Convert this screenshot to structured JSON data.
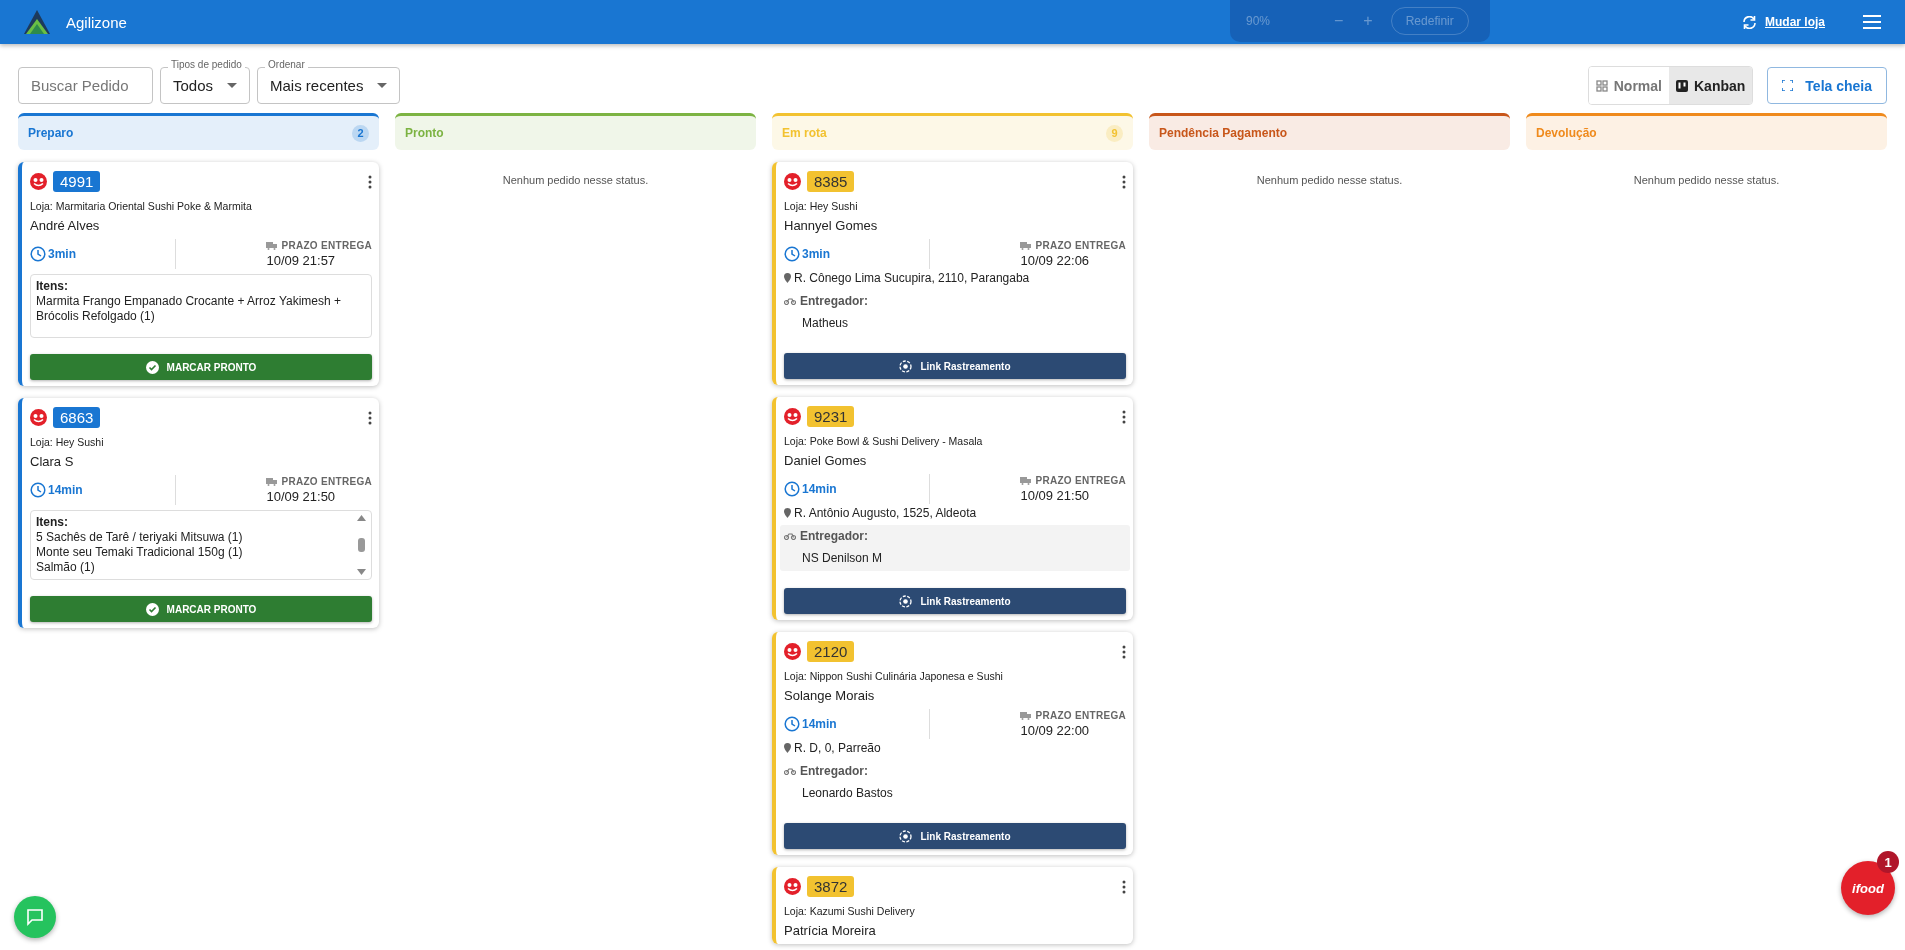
{
  "header": {
    "title": "Agilizone",
    "zoom": {
      "value": "90%",
      "minus": "−",
      "plus": "+",
      "reset": "Redefinir"
    },
    "store_link": "Mudar loja"
  },
  "toolbar": {
    "search": {
      "placeholder": "Buscar Pedido"
    },
    "filters": [
      {
        "label": "Tipos de pedido",
        "value": "Todos"
      },
      {
        "label": "Ordenar",
        "value": "Mais recentes"
      }
    ],
    "views": [
      {
        "label": "Normal",
        "selected": false,
        "kind": "grid"
      },
      {
        "label": "Kanban",
        "selected": true,
        "kind": "kanban"
      }
    ],
    "fullscreen": "Tela cheia"
  },
  "columns": [
    {
      "title": "Preparo",
      "color": "#1976d2",
      "count": "2",
      "cards": [
        {
          "number": "4991",
          "store": "Loja: Marmitaria Oriental Sushi Poke & Marmita",
          "customer": "André Alves",
          "elapsed": "3min",
          "deadline_label": "PRAZO ENTREGA",
          "deadline": "10/09 21:57",
          "items_label": "Itens:",
          "items": [
            "Marmita Frango Empanado Crocante + Arroz Yakimesh + Brócolis Refolgado (1)"
          ],
          "scrollable": false,
          "action": "MARCAR PRONTO"
        },
        {
          "number": "6863",
          "store": "Loja: Hey Sushi",
          "customer": "Clara S",
          "elapsed": "14min",
          "deadline_label": "PRAZO ENTREGA",
          "deadline": "10/09 21:50",
          "items_label": "Itens:",
          "items": [
            "5 Sachês de Tarê / teriyaki Mitsuwa (1)",
            "Monte seu Temaki Tradicional 150g (1)",
            "Salmão (1)"
          ],
          "scrollable": true,
          "action": "MARCAR PRONTO"
        }
      ]
    },
    {
      "title": "Pronto",
      "color": "#7cb342",
      "empty": "Nenhum pedido nesse status."
    },
    {
      "title": "Em rota",
      "color": "#f2c230",
      "count": "9",
      "cards": [
        {
          "number": "8385",
          "store": "Loja: Hey Sushi",
          "customer": "Hannyel Gomes",
          "elapsed": "3min",
          "deadline_label": "PRAZO ENTREGA",
          "deadline": "10/09 22:06",
          "address": "R. Cônego Lima Sucupira, 2110, Parangaba",
          "courier_label": "Entregador:",
          "courier": "Matheus",
          "highlighted": false,
          "action": "Link Rastreamento"
        },
        {
          "number": "9231",
          "store": "Loja: Poke Bowl & Sushi Delivery - Masala",
          "customer": "Daniel Gomes",
          "elapsed": "14min",
          "deadline_label": "PRAZO ENTREGA",
          "deadline": "10/09 21:50",
          "address": "R. Antônio Augusto, 1525, Aldeota",
          "courier_label": "Entregador:",
          "courier": "NS Denilson M",
          "highlighted": true,
          "action": "Link Rastreamento"
        },
        {
          "number": "2120",
          "store": "Loja: Nippon Sushi Culinária Japonesa e Sushi",
          "customer": "Solange Morais",
          "elapsed": "14min",
          "deadline_label": "PRAZO ENTREGA",
          "deadline": "10/09 22:00",
          "address": "R. D, 0, Parreão",
          "courier_label": "Entregador:",
          "courier": "Leonardo Bastos",
          "highlighted": false,
          "action": "Link Rastreamento"
        },
        {
          "number": "3872",
          "store": "Loja: Kazumi Sushi Delivery",
          "customer": "Patrícia Moreira"
        }
      ]
    },
    {
      "title": "Pendência Pagamento",
      "color": "#c8561a",
      "empty": "Nenhum pedido nesse status."
    },
    {
      "title": "Devolução",
      "color": "#ef8a1c",
      "empty": "Nenhum pedido nesse status."
    }
  ],
  "ifood": {
    "logo": "ifood",
    "badge": "1"
  }
}
